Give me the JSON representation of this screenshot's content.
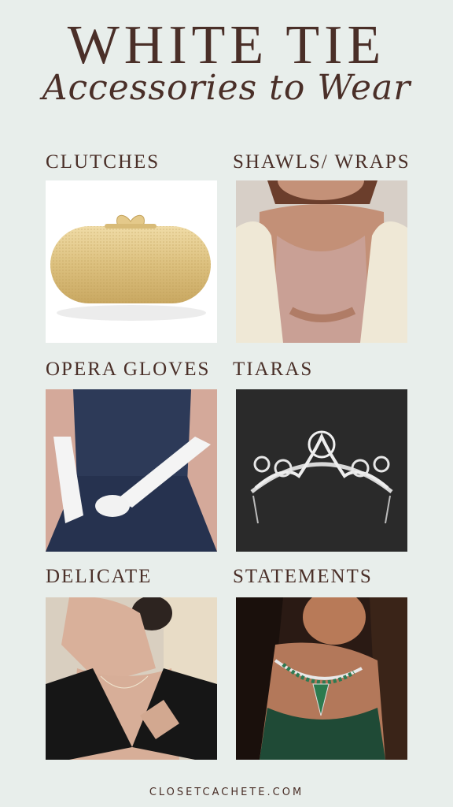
{
  "header": {
    "title": "WHITE TIE",
    "subtitle": "Accessories to Wear"
  },
  "sections": [
    {
      "label": "CLUTCHES"
    },
    {
      "label": "SHAWLS/ WRAPS"
    },
    {
      "label": "OPERA GLOVES"
    },
    {
      "label": "TIARAS"
    },
    {
      "label": "DELICATE"
    },
    {
      "label": "STATEMENTS"
    }
  ],
  "footer": {
    "site": "CLOSETCACHETE.COM"
  },
  "colors": {
    "background": "#e8eeeb",
    "text": "#4a2f28"
  }
}
